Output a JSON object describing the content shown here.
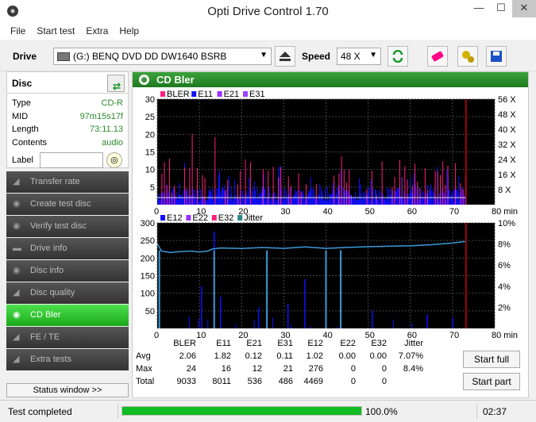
{
  "window": {
    "title": "Opti Drive Control 1.70",
    "minimize": "—",
    "maximize": "☐",
    "close": "✕"
  },
  "menu": [
    "File",
    "Start test",
    "Extra",
    "Help"
  ],
  "toolbar": {
    "drive_label": "Drive",
    "drive_value": "(G:)  BENQ DVD DD DW1640 BSRB",
    "speed_label": "Speed",
    "speed_value": "48 X"
  },
  "disc": {
    "header": "Disc",
    "fields": [
      {
        "label": "Type",
        "value": "CD-R"
      },
      {
        "label": "MID",
        "value": "97m15s17f"
      },
      {
        "label": "Length",
        "value": "73:11.13"
      },
      {
        "label": "Contents",
        "value": "audio"
      }
    ],
    "label_label": "Label",
    "label_value": ""
  },
  "nav": [
    {
      "label": "Transfer rate",
      "active": false
    },
    {
      "label": "Create test disc",
      "active": false
    },
    {
      "label": "Verify test disc",
      "active": false
    },
    {
      "label": "Drive info",
      "active": false
    },
    {
      "label": "Disc info",
      "active": false
    },
    {
      "label": "Disc quality",
      "active": false
    },
    {
      "label": "CD Bler",
      "active": true
    },
    {
      "label": "FE / TE",
      "active": false
    },
    {
      "label": "Extra tests",
      "active": false
    }
  ],
  "status_window_label": "Status window >>",
  "panel_title": "CD Bler",
  "colors": {
    "bler": "#ff1f7f",
    "e11": "#1010ff",
    "e21": "#9a30ff",
    "e31": "#a040ff",
    "e12": "#1010ff",
    "e22": "#9a30ff",
    "e32": "#ff1f7f",
    "jitter": "#3a9ad9",
    "accent": "#1aa81a",
    "marker": "#cc0000"
  },
  "chart_data": [
    {
      "type": "bar",
      "title": "",
      "legend": [
        "BLER",
        "E11",
        "E21",
        "E31"
      ],
      "legend_position": "top-left",
      "xlabel": "min",
      "x_ticks": [
        0,
        10,
        20,
        30,
        40,
        50,
        60,
        70,
        80
      ],
      "xlim": [
        0,
        80
      ],
      "y_ticks": [
        5,
        10,
        15,
        20,
        25,
        30
      ],
      "ylim": [
        0,
        30
      ],
      "y2_ticks": [
        "8 X",
        "16 X",
        "24 X",
        "32 X",
        "40 X",
        "48 X",
        "56 X"
      ],
      "y2lim": [
        0,
        56
      ],
      "end_marker_min": 73.2,
      "series": [
        {
          "name": "BLER",
          "max": 24,
          "avg": 2.06,
          "total": 9033
        },
        {
          "name": "E11",
          "max": 16,
          "avg": 1.82,
          "total": 8011
        },
        {
          "name": "E21",
          "max": 12,
          "avg": 0.12,
          "total": 536
        },
        {
          "name": "E31",
          "max": 21,
          "avg": 0.11,
          "total": 486
        }
      ]
    },
    {
      "type": "bar",
      "title": "",
      "legend": [
        "E12",
        "E22",
        "E32",
        "Jitter"
      ],
      "legend_position": "top-left",
      "xlabel": "min",
      "x_ticks": [
        0,
        10,
        20,
        30,
        40,
        50,
        60,
        70,
        80
      ],
      "xlim": [
        0,
        80
      ],
      "y_ticks": [
        50,
        100,
        150,
        200,
        250,
        300
      ],
      "ylim": [
        0,
        300
      ],
      "y2_ticks": [
        "2%",
        "4%",
        "6%",
        "8%",
        "10%"
      ],
      "y2lim": [
        0,
        10
      ],
      "end_marker_min": 73.2,
      "series": [
        {
          "name": "E12",
          "max": 276,
          "avg": 1.02,
          "total": 4469
        },
        {
          "name": "E22",
          "max": 0,
          "avg": 0.0,
          "total": 0
        },
        {
          "name": "E32",
          "max": 0,
          "avg": 0.0,
          "total": 0
        },
        {
          "name": "Jitter",
          "max_pct": 8.4,
          "avg_pct": 7.07,
          "points": [
            [
              0,
              8.0
            ],
            [
              1,
              7.3
            ],
            [
              3,
              7.2
            ],
            [
              5,
              7.3
            ],
            [
              8,
              7.4
            ],
            [
              10,
              7.2
            ],
            [
              12,
              7.3
            ],
            [
              13,
              7.5
            ],
            [
              15,
              7.6
            ],
            [
              20,
              7.6
            ],
            [
              25,
              7.6
            ],
            [
              30,
              7.6
            ],
            [
              35,
              7.7
            ],
            [
              40,
              7.6
            ],
            [
              45,
              7.7
            ],
            [
              50,
              7.8
            ],
            [
              55,
              7.8
            ],
            [
              60,
              7.9
            ],
            [
              65,
              8.0
            ],
            [
              70,
              8.1
            ],
            [
              73,
              8.2
            ]
          ],
          "spikes_min": [
            0.5,
            13.5,
            26,
            40,
            43.5
          ]
        }
      ]
    }
  ],
  "stats": {
    "headers": [
      "BLER",
      "E11",
      "E21",
      "E31",
      "E12",
      "E22",
      "E32",
      "Jitter"
    ],
    "rows": [
      {
        "label": "Avg",
        "values": [
          "2.06",
          "1.82",
          "0.12",
          "0.11",
          "1.02",
          "0.00",
          "0.00",
          "7.07%"
        ]
      },
      {
        "label": "Max",
        "values": [
          "24",
          "16",
          "12",
          "21",
          "276",
          "0",
          "0",
          "8.4%"
        ]
      },
      {
        "label": "Total",
        "values": [
          "9033",
          "8011",
          "536",
          "486",
          "4469",
          "0",
          "0",
          ""
        ]
      }
    ]
  },
  "buttons": {
    "start_full": "Start full",
    "start_part": "Start part"
  },
  "statusbar": {
    "status": "Test completed",
    "progress_percent": 100,
    "progress_text": "100.0%",
    "time": "02:37"
  }
}
